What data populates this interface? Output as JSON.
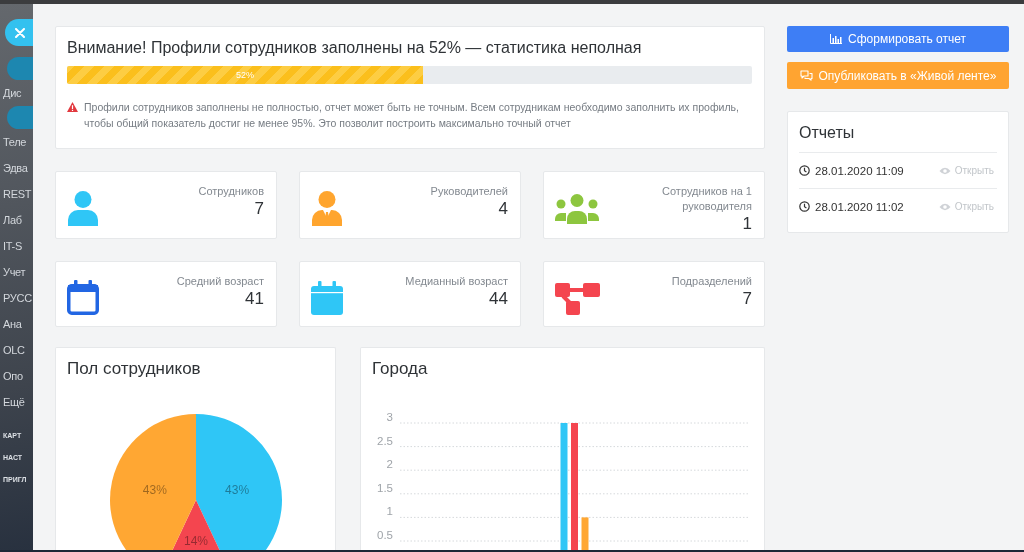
{
  "sidebar": {
    "items": [
      {
        "kind": "pill"
      },
      {
        "kind": "item",
        "label": "Дис"
      },
      {
        "kind": "pill"
      },
      {
        "kind": "item",
        "label": "Теле"
      },
      {
        "kind": "item",
        "label": "Эдва"
      },
      {
        "kind": "item",
        "label": "REST"
      },
      {
        "kind": "item",
        "label": "Лаб"
      },
      {
        "kind": "item",
        "label": "IT-S"
      },
      {
        "kind": "item",
        "label": "Учет"
      },
      {
        "kind": "item",
        "label": "РУСС"
      },
      {
        "kind": "item",
        "label": "Ана"
      },
      {
        "kind": "item",
        "label": "OLC"
      },
      {
        "kind": "item",
        "label": "Опо"
      },
      {
        "kind": "item",
        "label": "Ещё"
      },
      {
        "kind": "section",
        "label": "КАРТ"
      },
      {
        "kind": "section",
        "label": "НАСТ"
      },
      {
        "kind": "section",
        "label": "ПРИГЛ"
      }
    ]
  },
  "warning": {
    "title": "Внимание! Профили сотрудников заполнены на 52% — статистика неполная",
    "progress": {
      "level": 0.52,
      "label": "52%"
    },
    "note": "Профили сотрудников заполнены не полностью, отчет может быть не точным. Всем сотрудникам необходимо заполнить их профиль, чтобы общий показатель достиг не менее 95%. Это позволит построить максимально точный отчет"
  },
  "stats": [
    {
      "kind": "person",
      "color": "#2fc6f6",
      "label": "Сотрудников",
      "value": "7"
    },
    {
      "kind": "manager",
      "color": "#ffa52e",
      "label": "Руководителей",
      "value": "4"
    },
    {
      "kind": "group",
      "color": "#8dc63f",
      "label": "Сотрудников на 1 руководителя",
      "value": "1"
    },
    {
      "kind": "calendar-outline",
      "color": "#2266e3",
      "label": "Средний возраст",
      "value": "41"
    },
    {
      "kind": "calendar",
      "color": "#2fc6f6",
      "label": "Медианный возраст",
      "value": "44"
    },
    {
      "kind": "structure",
      "color": "#f4454f",
      "label": "Подразделений",
      "value": "7"
    }
  ],
  "gender_chart": {
    "chart_data": {
      "type": "pie",
      "title": "Пол сотрудников",
      "values": [
        43,
        14,
        43
      ],
      "colors": [
        "#2fc6f6",
        "#f4454f",
        "#ffa733"
      ],
      "value_labels": [
        "43%",
        "14%",
        "43%"
      ]
    }
  },
  "cities_chart": {
    "chart_data": {
      "type": "bar",
      "title": "Города",
      "ylim": [
        0,
        3
      ],
      "yticks": [
        0.5,
        1,
        1.5,
        2,
        2.5,
        3
      ],
      "grid": true,
      "series": [
        {
          "color": "#2fc6f6",
          "values": [
            3
          ]
        },
        {
          "color": "#f4454f",
          "values": [
            3
          ]
        },
        {
          "color": "#ffa733",
          "values": [
            1
          ]
        }
      ]
    }
  },
  "actions": [
    {
      "kind": "build",
      "label": "Сформировать отчет"
    },
    {
      "kind": "publish",
      "label": "Опубликовать в «Живой ленте»"
    }
  ],
  "reports": {
    "title": "Отчеты",
    "items": [
      {
        "date": "28.01.2020 11:09",
        "action": "Открыть"
      },
      {
        "date": "28.01.2020 11:02",
        "action": "Открыть"
      }
    ]
  }
}
